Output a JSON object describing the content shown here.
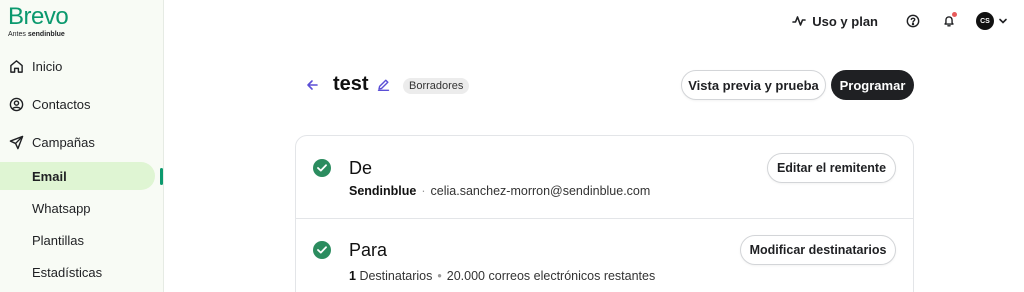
{
  "brand": {
    "name": "Brevo",
    "tagline_prefix": "Antes",
    "tagline_brand": "sendinblue"
  },
  "sidebar": {
    "items": [
      {
        "label": "Inicio",
        "icon": "home-icon"
      },
      {
        "label": "Contactos",
        "icon": "contacts-icon"
      },
      {
        "label": "Campañas",
        "icon": "send-icon"
      }
    ],
    "subitems": [
      {
        "label": "Email",
        "active": true
      },
      {
        "label": "Whatsapp"
      },
      {
        "label": "Plantillas"
      },
      {
        "label": "Estadísticas"
      }
    ]
  },
  "topbar": {
    "plan_label": "Uso y plan",
    "avatar_initials": "CS"
  },
  "header": {
    "title": "test",
    "status_badge": "Borradores",
    "preview_button": "Vista previa y prueba",
    "schedule_button": "Programar"
  },
  "sections": [
    {
      "title": "De",
      "detail_bold": "Sendinblue",
      "detail_text": "celia.sanchez-morron@sendinblue.com",
      "action": "Editar el remitente"
    },
    {
      "title": "Para",
      "detail_bold": "1",
      "detail_text": "Destinatarios",
      "detail_extra": "20.000 correos electrónicos restantes",
      "action": "Modificar destinatarios"
    }
  ],
  "colors": {
    "brand_green": "#0b996e",
    "active_bg": "#dff5d3",
    "check_green": "#2b8c5f",
    "accent_purple": "#5b4fd6",
    "dark_button": "#1f2023"
  }
}
